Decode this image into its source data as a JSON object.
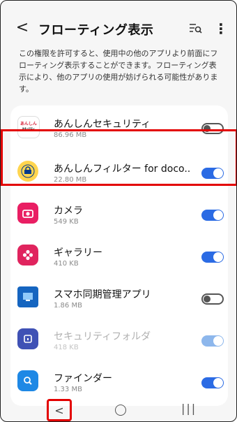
{
  "header": {
    "back_glyph": "<",
    "title": "フローティング表示",
    "search_icon": "search-list-icon",
    "menu_icon": "⋮"
  },
  "description": "この権限を許可すると、使用中の他のアプリより前面にフローティング表示することができます。フローティング表示により、他のアプリの使用が妨げられる可能性があります。",
  "apps": [
    {
      "name": "あんしんセキュリティ",
      "size": "86.96 MB",
      "toggle": "off",
      "icon_label": "あんしん\nセキュリティ",
      "icon": "anshin-security-icon"
    },
    {
      "name": "あんしんフィルター for doco..",
      "size": "22.80 MB",
      "toggle": "on",
      "icon_label": "",
      "icon": "anshin-filter-icon"
    },
    {
      "name": "カメラ",
      "size": "549 KB",
      "toggle": "on",
      "icon_label": "",
      "icon": "camera-icon"
    },
    {
      "name": "ギャラリー",
      "size": "410 KB",
      "toggle": "on",
      "icon_label": "",
      "icon": "gallery-icon"
    },
    {
      "name": "スマホ同期管理アプリ",
      "size": "1.86 MB",
      "toggle": "off",
      "icon_label": "",
      "icon": "sync-manager-icon"
    },
    {
      "name": "セキュリティフォルダ",
      "size": "418 KB",
      "toggle": "on-dim",
      "icon_label": "",
      "icon": "secure-folder-icon"
    },
    {
      "name": "ファインダー",
      "size": "1.33 MB",
      "toggle": "on",
      "icon_label": "",
      "icon": "finder-icon"
    }
  ],
  "navbar": {
    "back_glyph": "<",
    "home_icon": "home-icon",
    "recents_glyph": "|||"
  },
  "colors": {
    "accent": "#2b6be4",
    "highlight": "#e30000"
  }
}
